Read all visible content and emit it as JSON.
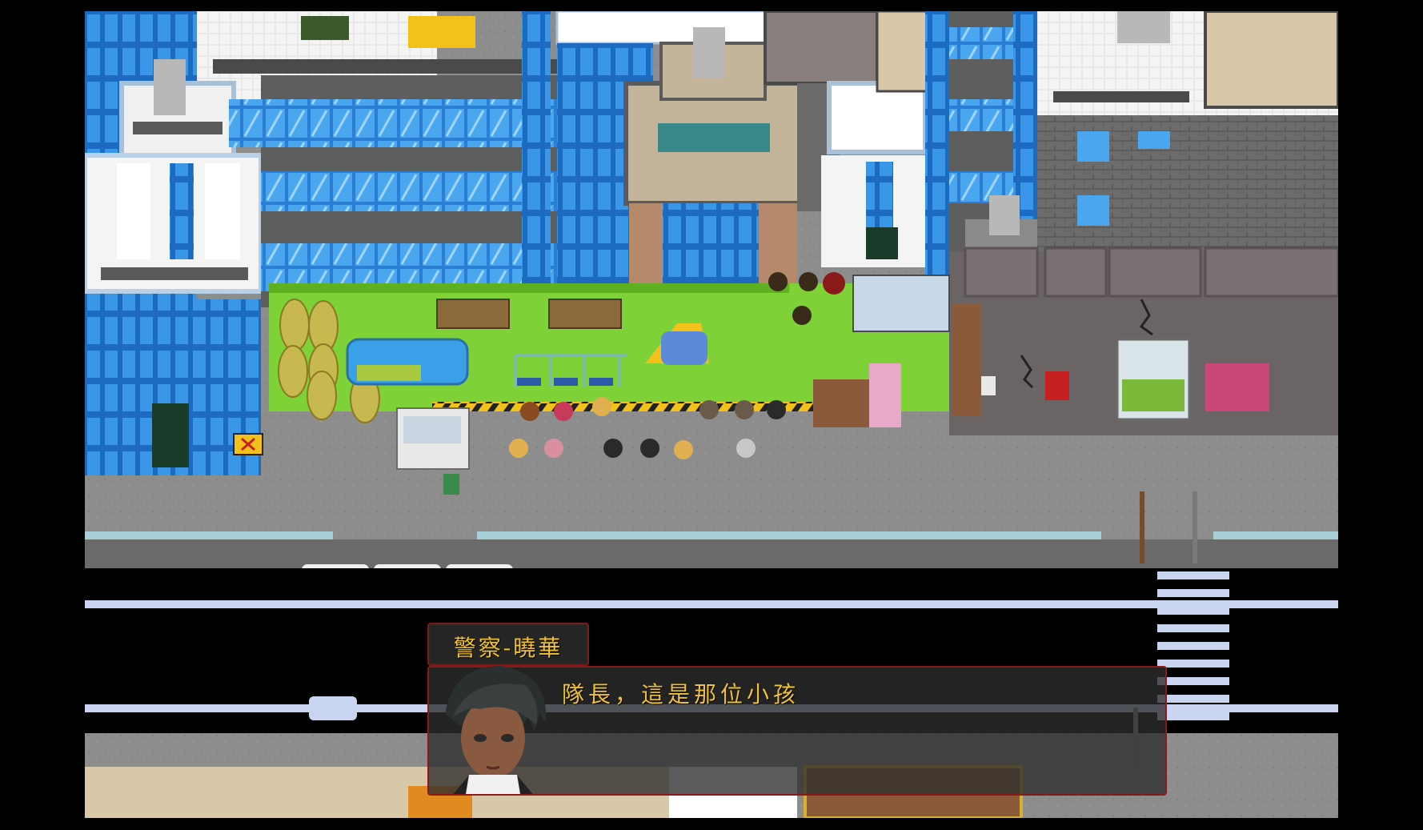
{
  "dialogue": {
    "speaker": "警察-曉華",
    "text": "隊長，這是那位小孩"
  },
  "icons": {
    "portrait": "dark-haired-officer-portrait",
    "barrier_sign": "road-closed-sign-icon",
    "phone": "public-phone-icon"
  },
  "colors": {
    "dialogue_text": "#f1c232",
    "dialogue_border": "#8a1a1a",
    "grass": "#7ed136",
    "road": "#000000",
    "crosswalk": "#c8d4f0",
    "water": "#3aa0e8"
  }
}
